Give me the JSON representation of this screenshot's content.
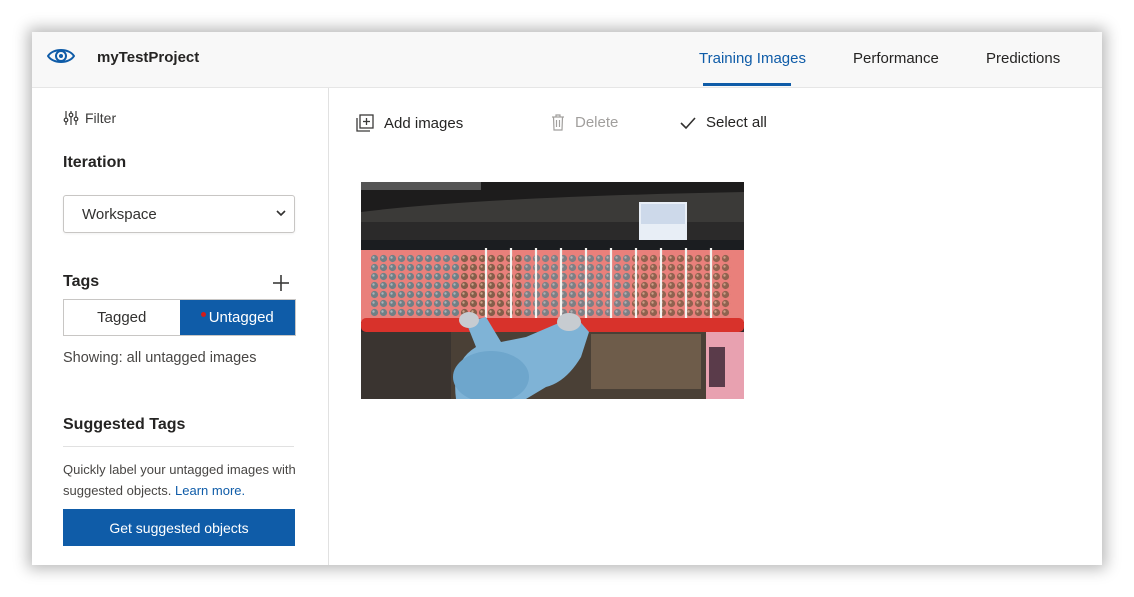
{
  "header": {
    "project_name": "myTestProject",
    "tabs": [
      {
        "label": "Training Images",
        "active": true
      },
      {
        "label": "Performance",
        "active": false
      },
      {
        "label": "Predictions",
        "active": false
      }
    ]
  },
  "sidebar": {
    "filter_label": "Filter",
    "iteration": {
      "heading": "Iteration",
      "selected": "Workspace"
    },
    "tags": {
      "heading": "Tags",
      "options": [
        "Tagged",
        "Untagged"
      ],
      "selected": "Untagged",
      "showing_text": "Showing: all untagged images"
    },
    "suggested": {
      "heading": "Suggested Tags",
      "description": "Quickly label your untagged images with suggested objects.",
      "link": "Learn more.",
      "button_label": "Get suggested objects"
    }
  },
  "toolbar": {
    "add_images": "Add images",
    "delete": "Delete",
    "select_all": "Select all"
  },
  "colors": {
    "accent": "#0f5ca8",
    "untagged_dot": "#d11b1b"
  },
  "icons": [
    "eye-logo-icon",
    "filter-icon",
    "chevron-down-icon",
    "plus-icon",
    "add-images-icon",
    "trash-icon",
    "checkmark-icon"
  ]
}
